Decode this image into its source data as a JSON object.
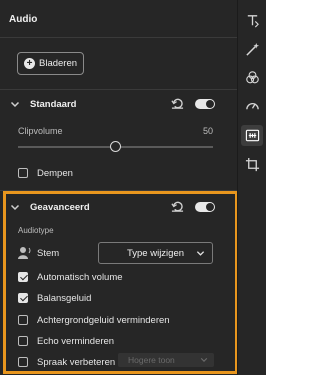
{
  "panel": {
    "title": "Audio"
  },
  "browse": {
    "label": "Bladeren"
  },
  "standard": {
    "title": "Standaard",
    "clip_volume_label": "Clipvolume",
    "clip_volume_value": "50",
    "clip_volume_fraction": 0.5,
    "mute_label": "Dempen",
    "mute_checked": false,
    "enabled": true
  },
  "advanced": {
    "title": "Geavanceerd",
    "enabled": true,
    "audiotype_label": "Audiotype",
    "voice_label": "Stem",
    "type_select": "Type wijzigen",
    "options": [
      {
        "label": "Automatisch volume",
        "checked": true
      },
      {
        "label": "Balansgeluid",
        "checked": true
      },
      {
        "label": "Achtergrondgeluid verminderen",
        "checked": false
      },
      {
        "label": "Echo verminderen",
        "checked": false
      },
      {
        "label": "Spraak verbeteren",
        "checked": false
      }
    ],
    "speech_select": "Hogere toon"
  },
  "tool_rail": {
    "icons": [
      "text-icon",
      "magic-wand-icon",
      "filters-icon",
      "speed-gauge-icon",
      "audio-adjust-icon",
      "crop-icon"
    ],
    "active": "audio-adjust-icon"
  },
  "colors": {
    "panel_bg": "#262626",
    "highlight": "#e8961e"
  }
}
